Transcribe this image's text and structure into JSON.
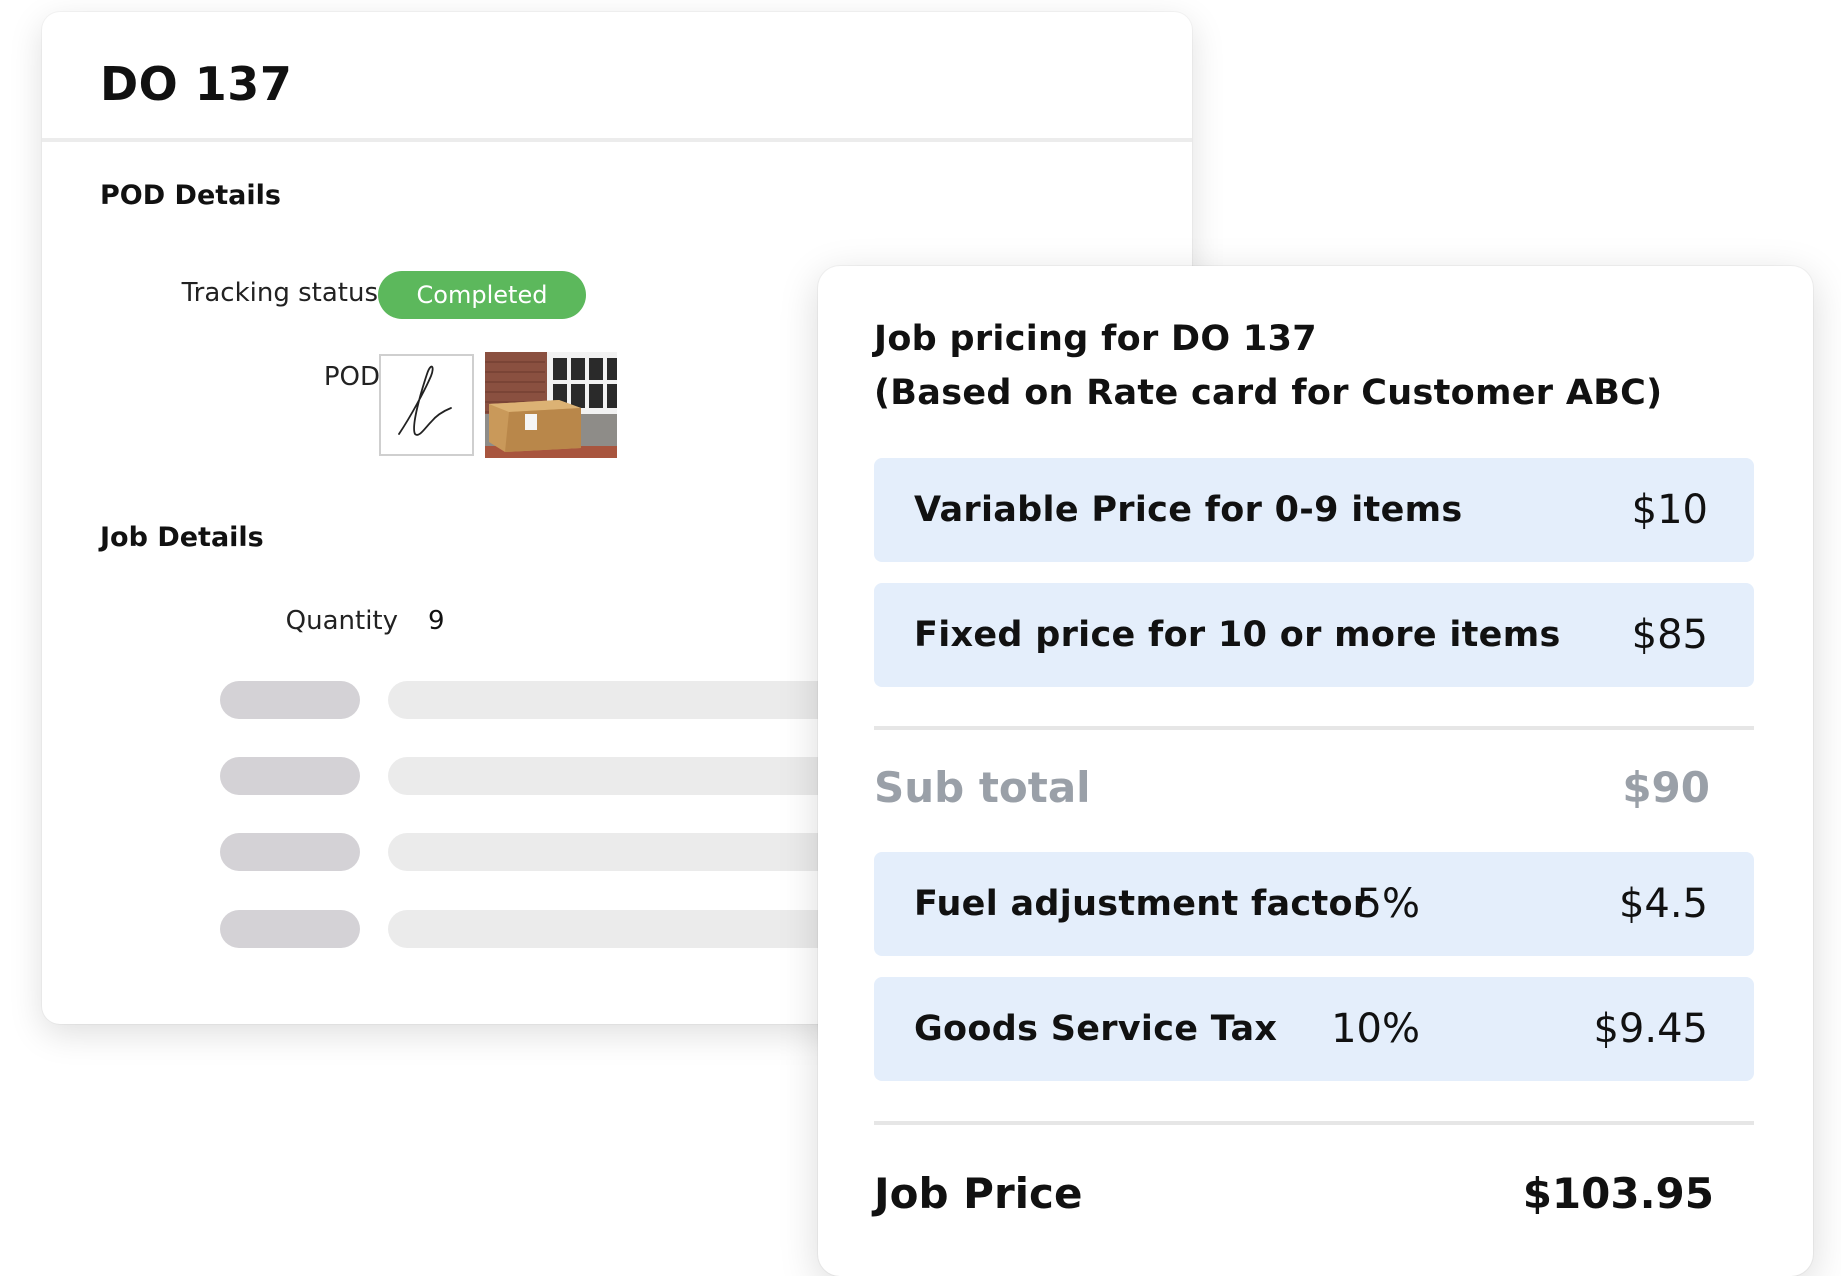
{
  "order": {
    "title": "DO 137",
    "pod_section": {
      "title": "POD Details",
      "tracking_status_label": "Tracking status",
      "tracking_status_value": "Completed",
      "pod_label": "POD"
    },
    "job_section": {
      "title": "Job Details",
      "quantity_label": "Quantity",
      "quantity_value": "9"
    }
  },
  "pricing": {
    "title_line1": "Job pricing for DO 137",
    "title_line2": "(Based on Rate card for Customer ABC)",
    "rows": [
      {
        "label": "Variable Price for 0-9 items",
        "amount": "$10"
      },
      {
        "label": "Fixed price for 10 or more items",
        "amount": "$85"
      }
    ],
    "subtotal": {
      "label": "Sub total",
      "amount": "$90"
    },
    "adjustments": [
      {
        "label": "Fuel adjustment factor",
        "percent": "5%",
        "amount": "$4.5"
      },
      {
        "label": "Goods Service Tax",
        "percent": "10%",
        "amount": "$9.45"
      }
    ],
    "total": {
      "label": "Job Price",
      "amount": "$103.95"
    }
  },
  "colors": {
    "status_badge": "#5cb85c",
    "row_background": "#e4eefb",
    "subtotal_text": "#9aa0a8",
    "placeholder_label": "#d4d2d6",
    "placeholder_value": "#ebebeb"
  },
  "icons": {
    "signature": "signature-thumbnail",
    "delivery_photo": "delivered-package-photo"
  }
}
